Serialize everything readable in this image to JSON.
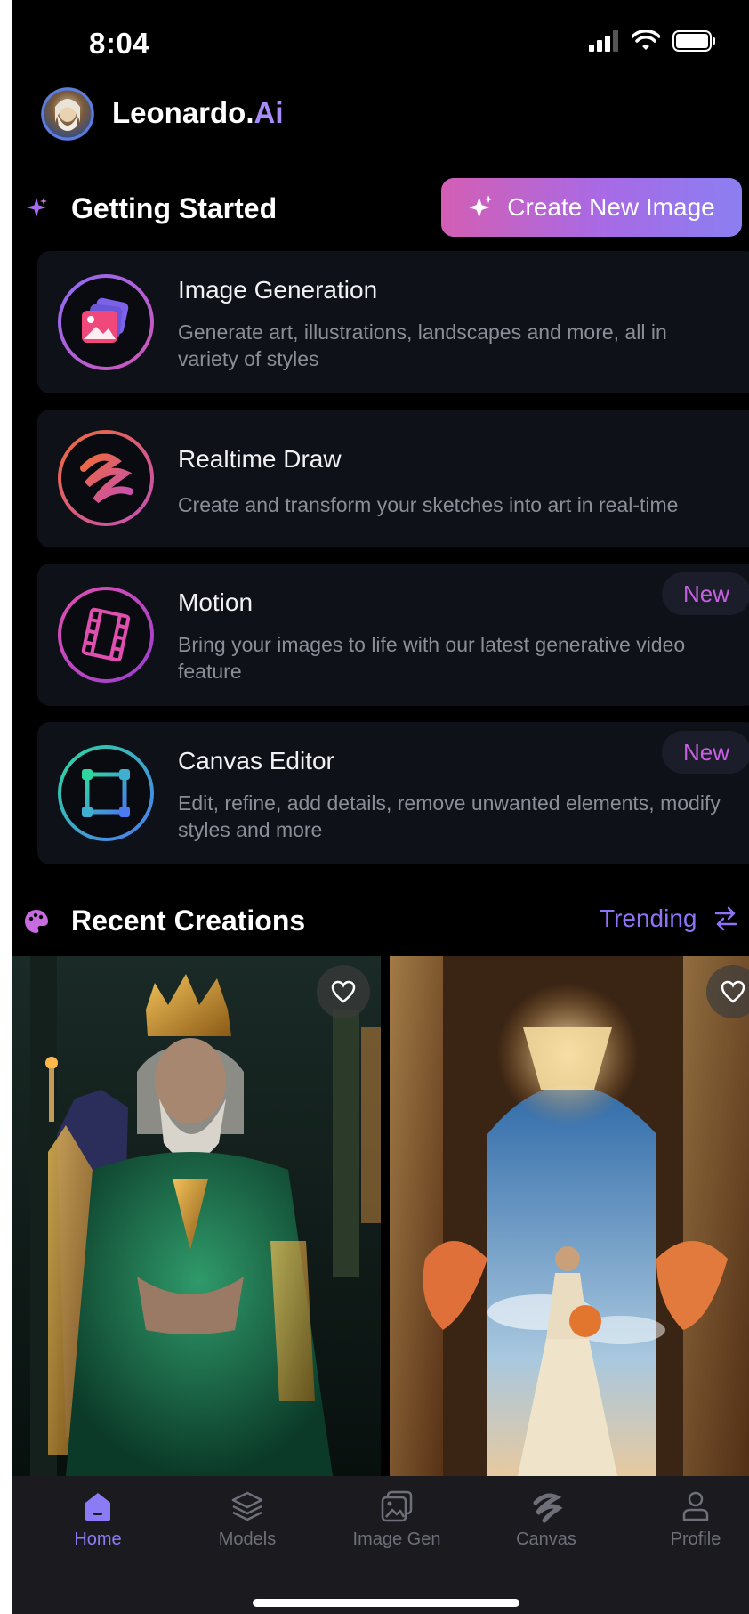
{
  "status_bar": {
    "time": "8:04"
  },
  "header": {
    "brand_name": "Leonardo",
    "brand_dot": ".",
    "brand_suffix": "Ai"
  },
  "getting_started": {
    "title": "Getting Started",
    "create_button_label": "Create New Image",
    "cards": [
      {
        "title": "Image Generation",
        "description": "Generate art, illustrations, landscapes and more, all in variety of styles",
        "icon": "image-stack-icon"
      },
      {
        "title": "Realtime Draw",
        "description": "Create and transform your sketches into art in real-time",
        "icon": "scribble-icon"
      },
      {
        "title": "Motion",
        "description": "Bring your images to life with our latest generative video feature",
        "badge": "New",
        "icon": "film-strip-icon"
      },
      {
        "title": "Canvas Editor",
        "description": "Edit, refine, add details, remove unwanted elements, modify styles and more",
        "badge": "New",
        "icon": "canvas-square-icon"
      }
    ]
  },
  "recent_creations": {
    "title": "Recent Creations",
    "filter_label": "Trending",
    "images": [
      {
        "subject": "king-on-throne",
        "icon": "heart-icon"
      },
      {
        "subject": "bride-in-palace",
        "icon": "heart-icon"
      }
    ]
  },
  "bottom_nav": {
    "items": [
      {
        "label": "Home",
        "icon": "home-icon",
        "active": true
      },
      {
        "label": "Models",
        "icon": "layers-icon"
      },
      {
        "label": "Image Gen",
        "icon": "image-gen-icon"
      },
      {
        "label": "Canvas",
        "icon": "canvas-brush-icon"
      },
      {
        "label": "Profile",
        "icon": "profile-icon"
      }
    ]
  },
  "colors": {
    "accent": "#8b7cf5",
    "brand_ai": "#a78bfa",
    "card_bg": "#0f1118",
    "badge_text": "#c85ee0"
  }
}
